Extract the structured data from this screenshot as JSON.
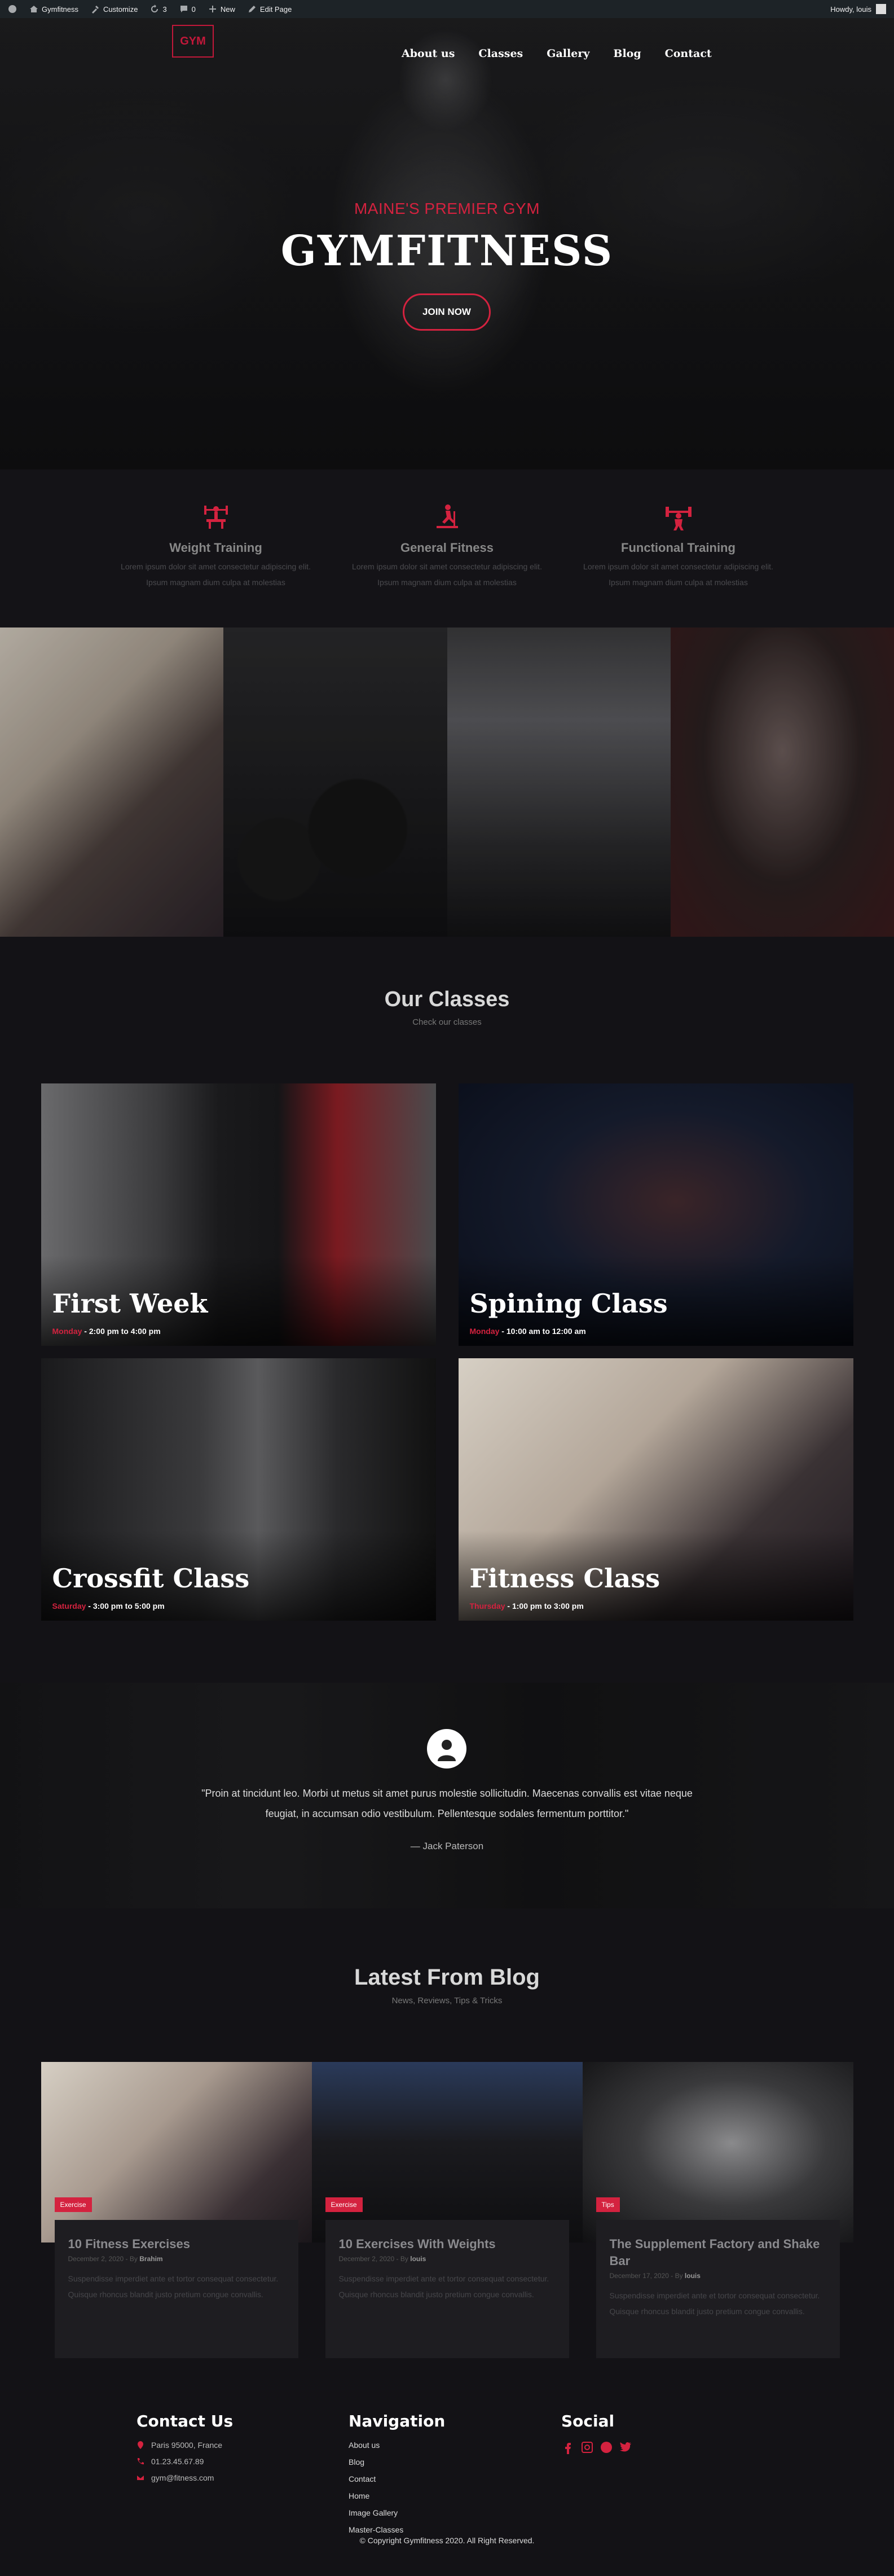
{
  "adminbar": {
    "site": "Gymfitness",
    "customize": "Customize",
    "updates": "3",
    "comments": "0",
    "new": "New",
    "edit": "Edit Page",
    "howdy": "Howdy, louis"
  },
  "nav": {
    "logo": "GYM",
    "items": [
      "About us",
      "Classes",
      "Gallery",
      "Blog",
      "Contact"
    ]
  },
  "hero": {
    "subtitle": "MAINE'S PREMIER GYM",
    "title": "GYMFITNESS",
    "cta": "JOIN NOW"
  },
  "features": [
    {
      "icon": "weight-bench-icon",
      "title": "Weight Training",
      "text1": "Lorem ipsum dolor sit amet consectetur adipiscing elit.",
      "text2": "Ipsum magnam dium culpa at molestias"
    },
    {
      "icon": "treadmill-icon",
      "title": "General Fitness",
      "text1": "Lorem ipsum dolor sit amet consectetur adipiscing elit.",
      "text2": "Ipsum magnam dium culpa at molestias"
    },
    {
      "icon": "weightlifter-icon",
      "title": "Functional Training",
      "text1": "Lorem ipsum dolor sit amet consectetur adipiscing elit.",
      "text2": "Ipsum magnam dium culpa at molestias"
    }
  ],
  "classes": {
    "title": "Our Classes",
    "subtitle": "Check our classes",
    "items": [
      {
        "name": "First Week",
        "day": "Monday",
        "time": " - 2:00 pm to 4:00 pm"
      },
      {
        "name": "Spining Class",
        "day": "Monday",
        "time": " - 10:00 am to 12:00 am"
      },
      {
        "name": "Crossfit Class",
        "day": "Saturday",
        "time": " - 3:00 pm to 5:00 pm"
      },
      {
        "name": "Fitness Class",
        "day": "Thursday",
        "time": " - 1:00 pm to 3:00 pm"
      }
    ]
  },
  "testimonial": {
    "quote": "\"Proin at tincidunt leo. Morbi ut metus sit amet purus molestie sollicitudin. Maecenas convallis est vitae neque feugiat, in accumsan odio vestibulum. Pellentesque sodales fermentum porttitor.\"",
    "author": "— Jack Paterson"
  },
  "blog": {
    "title": "Latest From Blog",
    "subtitle": "News, Reviews, Tips & Tricks",
    "posts": [
      {
        "tag": "Exercise",
        "title": "10 Fitness Exercises",
        "date": "December 2, 2020 - By",
        "author": "Brahim",
        "excerpt1": "Suspendisse imperdiet ante et tortor consequat consectetur.",
        "excerpt2": "Quisque rhoncus blandit justo pretium congue convallis."
      },
      {
        "tag": "Exercise",
        "title": "10 Exercises With Weights",
        "date": "December 2, 2020 - By",
        "author": "louis",
        "excerpt1": "Suspendisse imperdiet ante et tortor consequat consectetur.",
        "excerpt2": "Quisque rhoncus blandit justo pretium congue convallis."
      },
      {
        "tag": "Tips",
        "title": "The Supplement Factory and Shake Bar",
        "date": "December 17, 2020 - By",
        "author": "louis",
        "excerpt1": "Suspendisse imperdiet ante et tortor consequat consectetur.",
        "excerpt2": "Quisque rhoncus blandit justo pretium congue convallis."
      }
    ]
  },
  "footer": {
    "contact_title": "Contact Us",
    "address": "Paris 95000, France",
    "phone": "01.23.45.67.89",
    "email": "gym@fitness.com",
    "nav_title": "Navigation",
    "nav_links": [
      "About us",
      "Blog",
      "Contact",
      "Home",
      "Image Gallery",
      "Master-Classes"
    ],
    "social_title": "Social",
    "social_icons": [
      "facebook-icon",
      "instagram-icon",
      "snapchat-icon",
      "twitter-icon"
    ],
    "copyright": "© Copyright Gymfitness 2020. All Right Reserved."
  },
  "colors": {
    "accent": "#d4223f",
    "background": "#131216"
  }
}
